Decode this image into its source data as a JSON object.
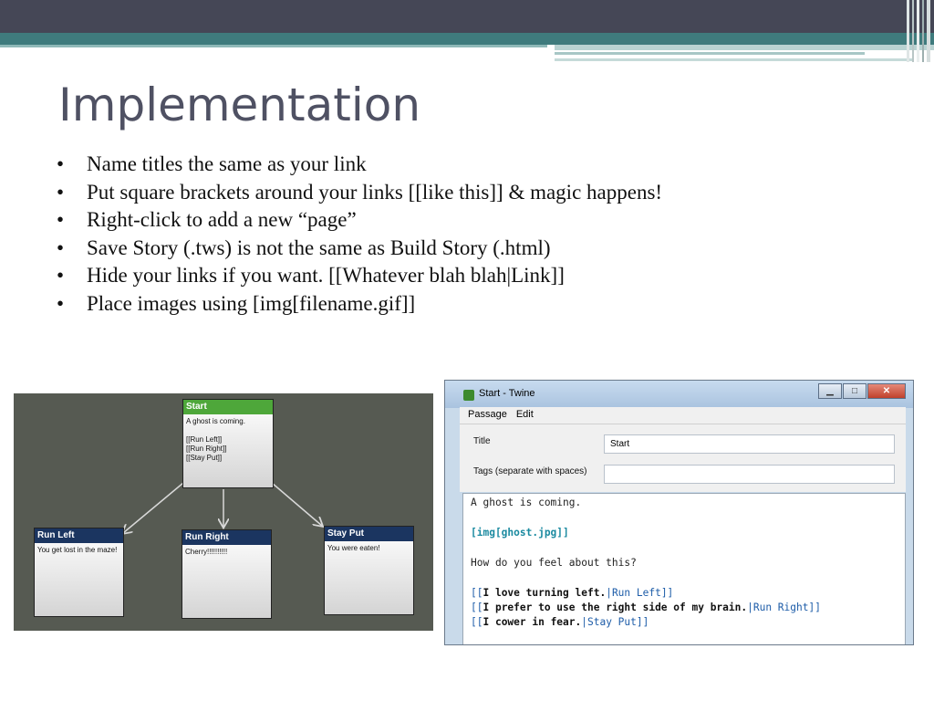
{
  "slide": {
    "title": "Implementation",
    "bullets": [
      {
        "bullet": "•",
        "text": "Name titles the same as your link"
      },
      {
        "bullet": "•",
        "text": "Put square brackets around your links [[like this]] & magic happens!"
      },
      {
        "bullet": "•",
        "text": "Right-click to add a new “page”"
      },
      {
        "bullet": "•",
        "text": "Save Story (.tws) is not the same as Build Story (.html)"
      },
      {
        "bullet": "•",
        "text": "Hide your links if you want. [[Whatever blah blah|Link]]"
      },
      {
        "bullet": "•",
        "text": "Place images using [img[filename.gif]]"
      }
    ]
  },
  "diagram": {
    "passages": [
      {
        "title": "Start",
        "body": "A ghost is coming.\n\n[[Run Left]]\n[[Run Right]]\n[[Stay Put]]"
      },
      {
        "title": "Run Left",
        "body": "You get lost in the maze!"
      },
      {
        "title": "Run Right",
        "body": "Cherry!!!!!!!!!!"
      },
      {
        "title": "Stay Put",
        "body": "You were eaten!"
      }
    ],
    "colors": {
      "background": "#565a52",
      "start_header": "#4ea73a",
      "passage_header": "#1b3560"
    }
  },
  "twine_window": {
    "title": "Start - Twine",
    "window_buttons": {
      "minimize": "▁",
      "maximize": "□",
      "close": "✕"
    },
    "menu": [
      "Passage",
      "Edit"
    ],
    "title_label": "Title",
    "title_value": "Start",
    "tags_label": "Tags (separate with spaces)",
    "tags_value": "",
    "editor": {
      "line1": "A ghost is coming.",
      "line2": "[img[ghost.jpg]]",
      "line3": "How do you feel about this?",
      "links": [
        {
          "open": "[[",
          "text": "I love turning left.",
          "target": "|Run Left]]"
        },
        {
          "open": "[[",
          "text": "I prefer to use the right side of my brain.",
          "target": "|Run Right]]"
        },
        {
          "open": "[[",
          "text": "I cower in fear.",
          "target": "|Stay Put]]"
        }
      ]
    }
  }
}
